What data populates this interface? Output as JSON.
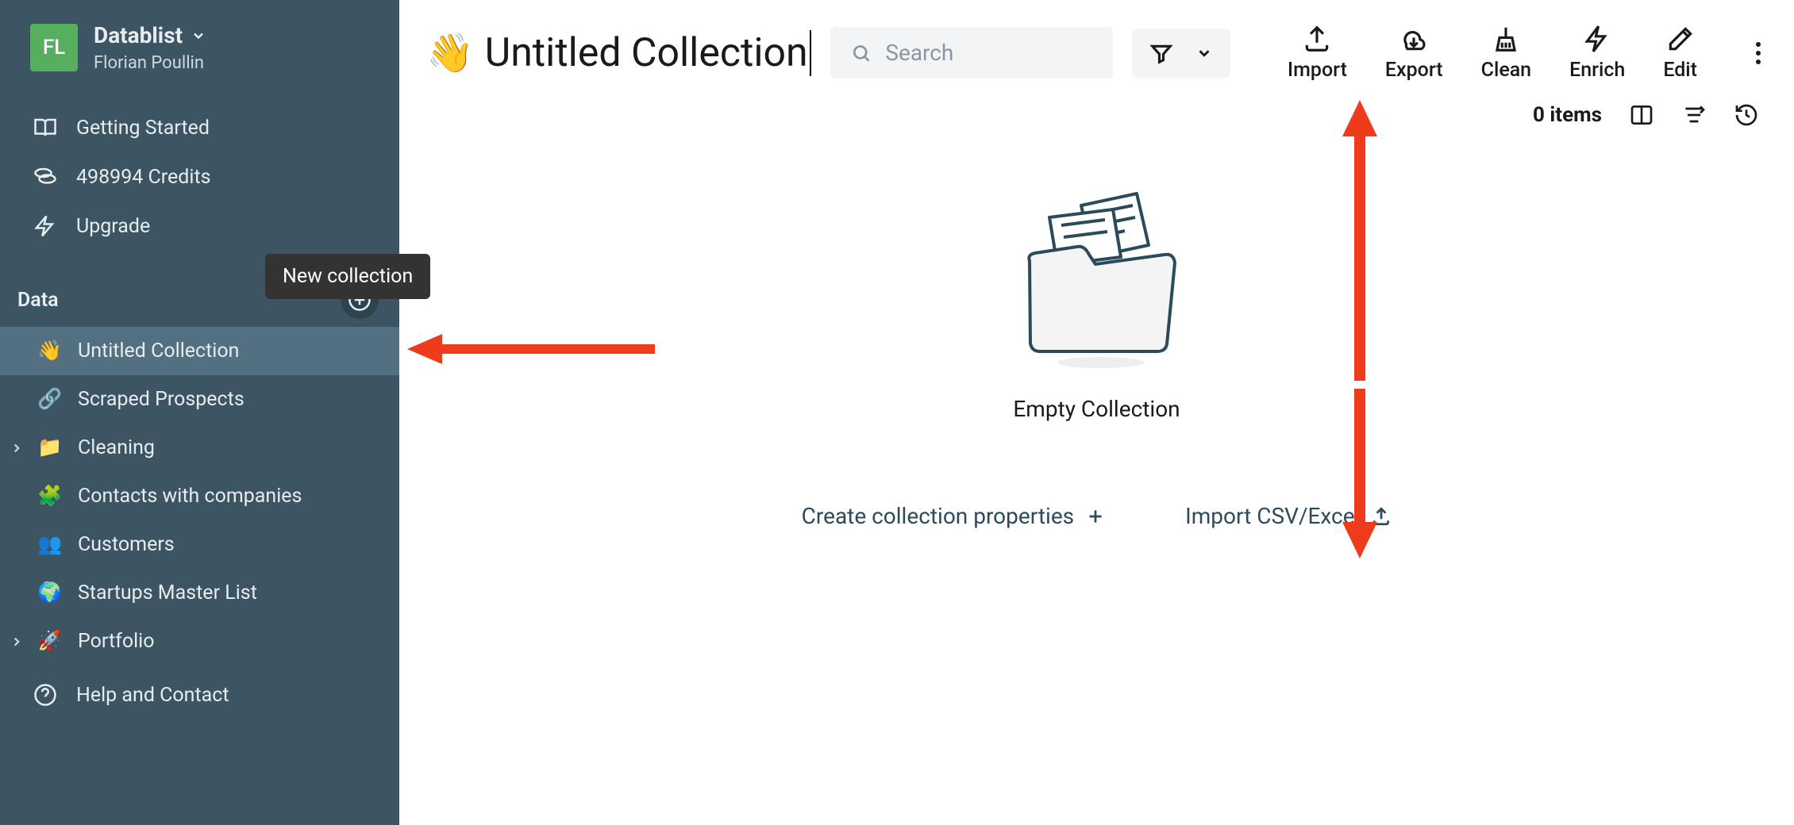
{
  "sidebar": {
    "avatar_initials": "FL",
    "app_name": "Datablist",
    "user_name": "Florian Poullin",
    "nav": {
      "getting_started": "Getting Started",
      "credits": "498994 Credits",
      "upgrade": "Upgrade"
    },
    "data_header": "Data",
    "tooltip": "New collection",
    "help": "Help and Contact",
    "collections": [
      {
        "emoji": "👋",
        "label": "Untitled Collection",
        "active": true,
        "has_children": false
      },
      {
        "emoji": "🔗",
        "label": "Scraped Prospects",
        "active": false,
        "has_children": false
      },
      {
        "emoji": "📁",
        "label": "Cleaning",
        "active": false,
        "has_children": true
      },
      {
        "emoji": "🧩",
        "label": "Contacts with companies",
        "active": false,
        "has_children": false
      },
      {
        "emoji": "👥",
        "label": "Customers",
        "active": false,
        "has_children": false
      },
      {
        "emoji": "🌍",
        "label": "Startups Master List",
        "active": false,
        "has_children": false
      },
      {
        "emoji": "🚀",
        "label": "Portfolio",
        "active": false,
        "has_children": true
      }
    ]
  },
  "header": {
    "title_emoji": "👋",
    "title": "Untitled Collection",
    "search_placeholder": "Search"
  },
  "actions": {
    "import": "Import",
    "export": "Export",
    "clean": "Clean",
    "enrich": "Enrich",
    "edit": "Edit"
  },
  "subbar": {
    "item_count": "0 items"
  },
  "empty": {
    "heading": "Empty Collection",
    "create_props": "Create collection properties",
    "import_csv": "Import CSV/Excel"
  }
}
